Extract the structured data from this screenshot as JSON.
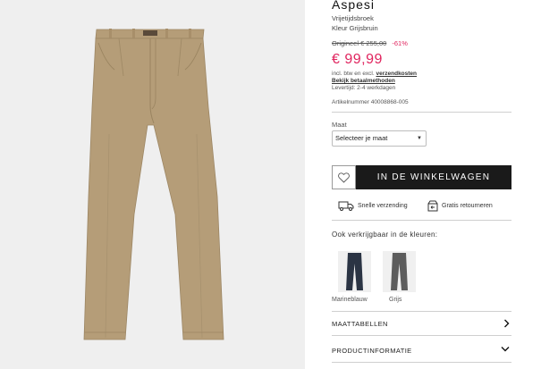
{
  "product": {
    "brand": "Aspesi",
    "type": "Vrijetijdsbroek",
    "color_line": "Kleur Grijsbruin",
    "original_price": "Origineel € 255,00",
    "discount": "-61%",
    "price": "€ 99,99",
    "tax_prefix": "incl. btw en excl.",
    "shipping_link": "verzendkosten",
    "payment_link": "Bekijk betaalmethoden",
    "delivery": "Levertijd: 2-4 werkdagen",
    "article": "Artikelnummer 40008868-005"
  },
  "size": {
    "label": "Maat",
    "selected": "Selecteer je maat"
  },
  "actions": {
    "add_to_cart": "IN DE WINKELWAGEN"
  },
  "usps": {
    "shipping": "Snelle verzending",
    "returns": "Gratis retourneren"
  },
  "colors": {
    "heading": "Ook verkrijgbaar in de kleuren:",
    "options": [
      {
        "name": "Marineblauw",
        "hex": "#2b3444"
      },
      {
        "name": "Grijs",
        "hex": "#5d5d5d"
      }
    ]
  },
  "accordion": {
    "size_tables": "MAATTABELLEN",
    "product_info": "PRODUCTINFORMATIE"
  },
  "theme": {
    "sale_color": "#e0245e",
    "button_color": "#1a1a1a",
    "product_color": "#b59d78"
  }
}
